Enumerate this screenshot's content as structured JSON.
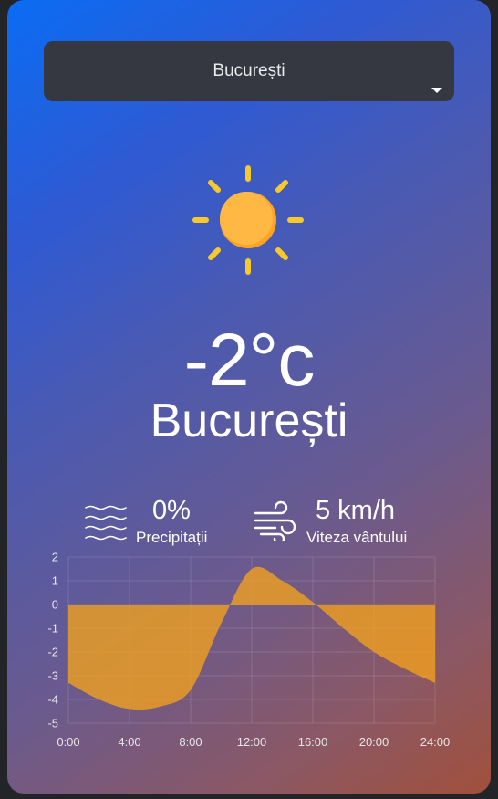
{
  "location_select": {
    "value": "București"
  },
  "weather": {
    "icon": "sun-icon",
    "temperature": "-2°c",
    "city": "București"
  },
  "stats": {
    "precipitation": {
      "icon": "waves-icon",
      "value": "0%",
      "label": "Precipitații"
    },
    "wind": {
      "icon": "wind-icon",
      "value": "5 km/h",
      "label": "Viteza vântului"
    }
  },
  "colors": {
    "fill": "#f3a21c",
    "sun": "#ffb03a",
    "ray": "#f7c92a"
  },
  "chart_data": {
    "type": "area",
    "x_tick_labels": [
      "0:00",
      "4:00",
      "8:00",
      "12:00",
      "16:00",
      "20:00",
      "24:00"
    ],
    "y_tick_labels": [
      "2",
      "1",
      "0",
      "-1",
      "-2",
      "-3",
      "-4",
      "-5"
    ],
    "x": [
      0,
      2,
      4,
      6,
      8,
      10,
      12,
      14,
      16,
      18,
      20,
      22,
      24
    ],
    "values": [
      -3.3,
      -4.0,
      -4.4,
      -4.3,
      -3.6,
      -0.8,
      1.5,
      1.0,
      0.1,
      -1.0,
      -2.0,
      -2.7,
      -3.3
    ],
    "xlim": [
      0,
      24
    ],
    "ylim": [
      -5,
      2
    ],
    "grid": true
  }
}
